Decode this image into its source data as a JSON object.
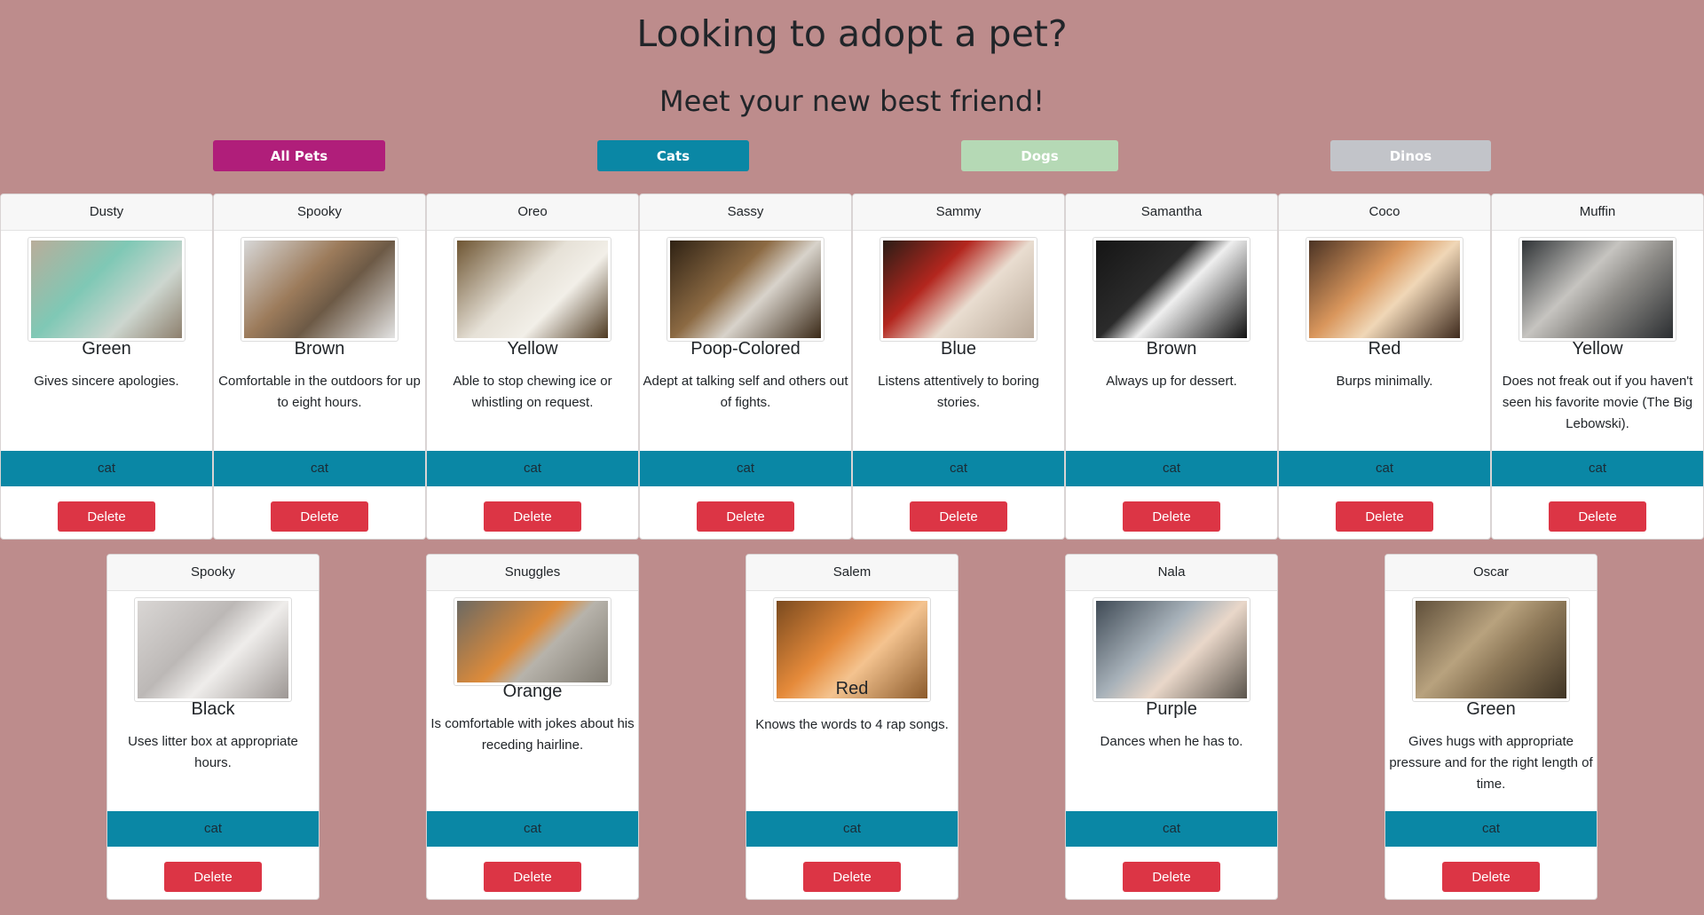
{
  "header": {
    "title": "Looking to adopt a pet?",
    "subtitle": "Meet your new best friend!"
  },
  "filters": [
    {
      "label": "All Pets",
      "color": "#b01e7a"
    },
    {
      "label": "Cats",
      "color": "#0a87a5"
    },
    {
      "label": "Dogs",
      "color": "#b5d9b5"
    },
    {
      "label": "Dinos",
      "color": "#c2c4c9"
    }
  ],
  "delete_label": "Delete",
  "pets": [
    {
      "name": "Dusty",
      "color": "Green",
      "description": "Gives sincere apologies.",
      "type": "cat",
      "image_icon": "cat-photo-icon"
    },
    {
      "name": "Spooky",
      "color": "Brown",
      "description": "Comfortable in the outdoors for up to eight hours.",
      "type": "cat",
      "image_icon": "cat-photo-icon"
    },
    {
      "name": "Oreo",
      "color": "Yellow",
      "description": "Able to stop chewing ice or whistling on request.",
      "type": "cat",
      "image_icon": "cat-photo-icon"
    },
    {
      "name": "Sassy",
      "color": "Poop-Colored",
      "description": "Adept at talking self and others out of fights.",
      "type": "cat",
      "image_icon": "cat-photo-icon"
    },
    {
      "name": "Sammy",
      "color": "Blue",
      "description": "Listens attentively to boring stories.",
      "type": "cat",
      "image_icon": "cat-photo-icon"
    },
    {
      "name": "Samantha",
      "color": "Brown",
      "description": "Always up for dessert.",
      "type": "cat",
      "image_icon": "cat-photo-icon"
    },
    {
      "name": "Coco",
      "color": "Red",
      "description": "Burps minimally.",
      "type": "cat",
      "image_icon": "cat-photo-icon"
    },
    {
      "name": "Muffin",
      "color": "Yellow",
      "description": "Does not freak out if you haven't seen his favorite movie (The Big Lebowski).",
      "type": "cat",
      "image_icon": "cat-photo-icon"
    },
    {
      "name": "Spooky",
      "color": "Black",
      "description": "Uses litter box at appropriate hours.",
      "type": "cat",
      "image_icon": "cat-photo-icon"
    },
    {
      "name": "Snuggles",
      "color": "Orange",
      "description": "Is comfortable with jokes about his receding hairline.",
      "type": "cat",
      "image_icon": "cat-photo-icon"
    },
    {
      "name": "Salem",
      "color": "Red",
      "description": "Knows the words to 4 rap songs.",
      "type": "cat",
      "image_icon": "cat-photo-icon"
    },
    {
      "name": "Nala",
      "color": "Purple",
      "description": "Dances when he has to.",
      "type": "cat",
      "image_icon": "cat-photo-icon"
    },
    {
      "name": "Oscar",
      "color": "Green",
      "description": "Gives hugs with appropriate pressure and for the right length of time.",
      "type": "cat",
      "image_icon": "cat-photo-icon"
    }
  ]
}
